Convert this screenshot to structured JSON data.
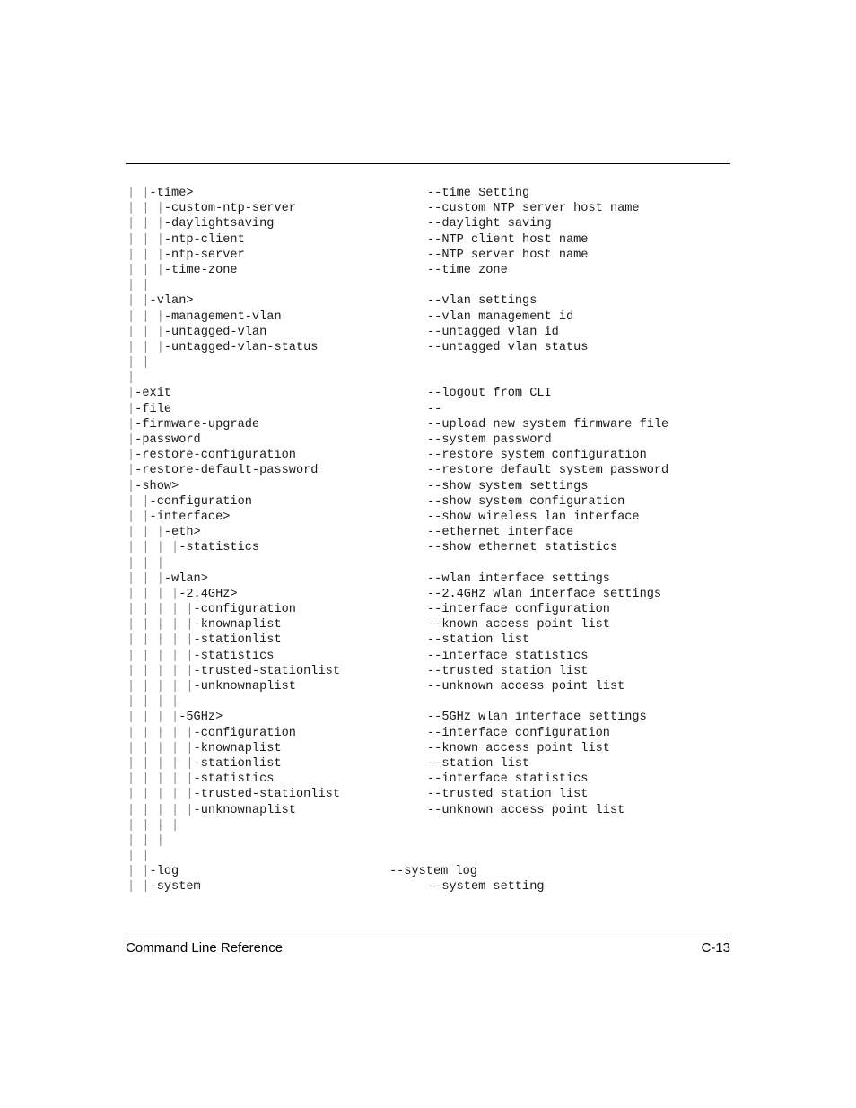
{
  "lines": [
    {
      "tree": "| |-time>",
      "desc": "--time Setting"
    },
    {
      "tree": "| | |-custom-ntp-server",
      "desc": "--custom NTP server host name"
    },
    {
      "tree": "| | |-daylightsaving",
      "desc": "--daylight saving"
    },
    {
      "tree": "| | |-ntp-client",
      "desc": "--NTP client host name"
    },
    {
      "tree": "| | |-ntp-server",
      "desc": "--NTP server host name"
    },
    {
      "tree": "| | |-time-zone",
      "desc": "--time zone"
    },
    {
      "tree": "| |",
      "desc": ""
    },
    {
      "tree": "| |-vlan>",
      "desc": "--vlan settings"
    },
    {
      "tree": "| | |-management-vlan",
      "desc": "--vlan management id"
    },
    {
      "tree": "| | |-untagged-vlan",
      "desc": "--untagged vlan id"
    },
    {
      "tree": "| | |-untagged-vlan-status",
      "desc": "--untagged vlan status"
    },
    {
      "tree": "| |",
      "desc": ""
    },
    {
      "tree": "|",
      "desc": ""
    },
    {
      "tree": "|-exit",
      "desc": "--logout from CLI"
    },
    {
      "tree": "|-file",
      "desc": "--"
    },
    {
      "tree": "|-firmware-upgrade",
      "desc": "--upload new system firmware file"
    },
    {
      "tree": "|-password",
      "desc": "--system password"
    },
    {
      "tree": "|-restore-configuration",
      "desc": "--restore system configuration"
    },
    {
      "tree": "|-restore-default-password",
      "desc": "--restore default system password"
    },
    {
      "tree": "|-show>",
      "desc": "--show system settings"
    },
    {
      "tree": "| |-configuration",
      "desc": "--show system configuration"
    },
    {
      "tree": "| |-interface>",
      "desc": "--show wireless lan interface"
    },
    {
      "tree": "| | |-eth>",
      "desc": "--ethernet interface"
    },
    {
      "tree": "| | | |-statistics",
      "desc": "--show ethernet statistics"
    },
    {
      "tree": "| | |",
      "desc": ""
    },
    {
      "tree": "| | |-wlan>",
      "desc": "--wlan interface settings"
    },
    {
      "tree": "| | | |-2.4GHz>",
      "desc": "--2.4GHz wlan interface settings"
    },
    {
      "tree": "| | | | |-configuration",
      "desc": "--interface configuration"
    },
    {
      "tree": "| | | | |-knownaplist",
      "desc": "--known access point list"
    },
    {
      "tree": "| | | | |-stationlist",
      "desc": "--station list"
    },
    {
      "tree": "| | | | |-statistics",
      "desc": "--interface statistics"
    },
    {
      "tree": "| | | | |-trusted-stationlist",
      "desc": "--trusted station list"
    },
    {
      "tree": "| | | | |-unknownaplist",
      "desc": "--unknown access point list"
    },
    {
      "tree": "| | | |",
      "desc": ""
    },
    {
      "tree": "| | | |-5GHz>",
      "desc": "--5GHz wlan interface settings"
    },
    {
      "tree": "| | | | |-configuration",
      "desc": "--interface configuration"
    },
    {
      "tree": "| | | | |-knownaplist",
      "desc": "--known access point list"
    },
    {
      "tree": "| | | | |-stationlist",
      "desc": "--station list"
    },
    {
      "tree": "| | | | |-statistics",
      "desc": "--interface statistics"
    },
    {
      "tree": "| | | | |-trusted-stationlist",
      "desc": "--trusted station list"
    },
    {
      "tree": "| | | | |-unknownaplist",
      "desc": "--unknown access point list"
    },
    {
      "tree": "| | | |",
      "desc": ""
    },
    {
      "tree": "| | |",
      "desc": ""
    },
    {
      "tree": "| |",
      "desc": ""
    },
    {
      "tree": "| |-log",
      "desc": "--system log",
      "shift": true
    },
    {
      "tree": "| |-system",
      "desc": "--system setting"
    }
  ],
  "footer": {
    "title": "Command Line Reference",
    "page": "C-13"
  }
}
